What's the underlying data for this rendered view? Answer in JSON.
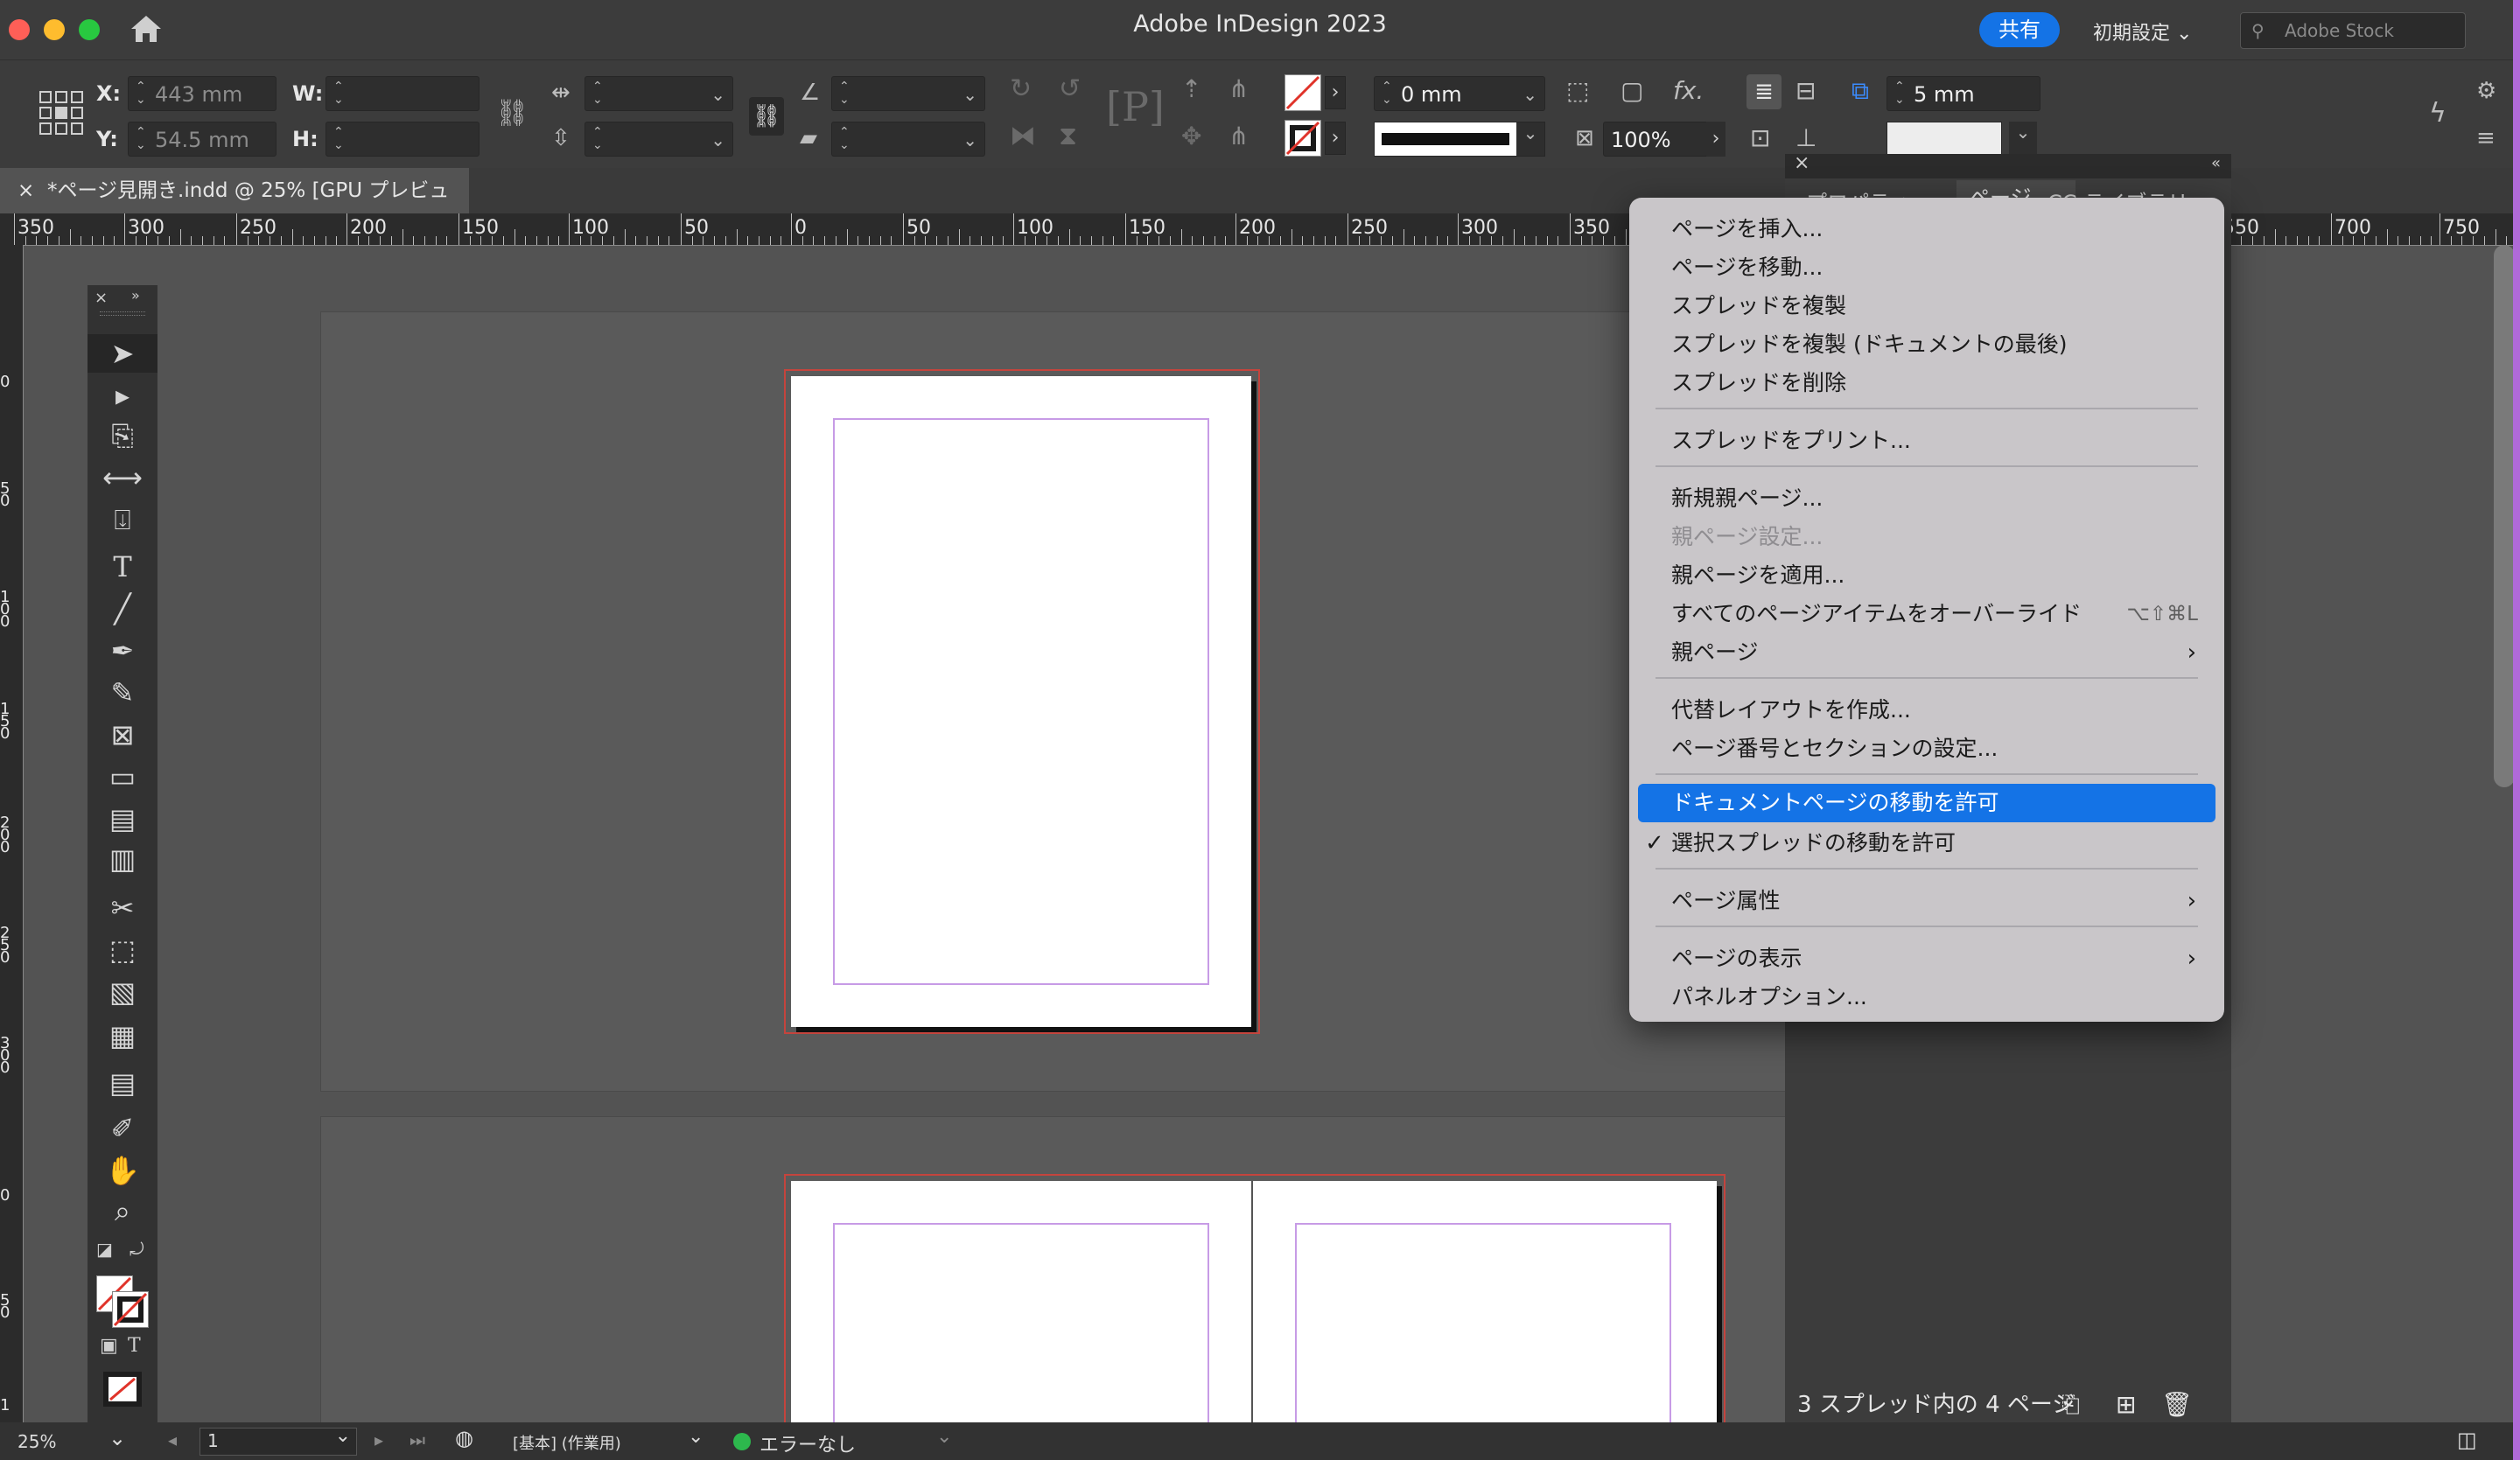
{
  "app": {
    "title": "Adobe InDesign 2023",
    "share_label": "共有",
    "workspace": "初期設定",
    "stock_placeholder": "Adobe Stock"
  },
  "control": {
    "x_label": "X:",
    "x_value": "443 mm",
    "y_label": "Y:",
    "y_value": "54.5 mm",
    "w_label": "W:",
    "w_value": "",
    "h_label": "H:",
    "h_value": "",
    "stroke_weight": "0 mm",
    "opacity": "100%",
    "spacing": "5 mm"
  },
  "tab": {
    "label": "*ページ見開き.indd @ 25% [GPU プレビュー]"
  },
  "ruler": {
    "labels": [
      "350",
      "300",
      "250",
      "200",
      "150",
      "100",
      "50",
      "0",
      "50",
      "100",
      "150",
      "200",
      "250",
      "300",
      "350",
      "550",
      "700",
      "750"
    ],
    "vlabels": [
      "0",
      "5\n0",
      "1\n0\n0",
      "1\n5\n0",
      "2\n0\n0",
      "2\n5\n0",
      "3\n0\n0",
      "0",
      "5\n0",
      "1"
    ]
  },
  "panel": {
    "tab1": "プロパティ",
    "tab2": "ページ",
    "tab3": "CC ライブラリ",
    "footer": "3 スプレッド内の 4 ページ"
  },
  "menu": {
    "items": [
      {
        "label": "ページを挿入..."
      },
      {
        "label": "ページを移動..."
      },
      {
        "label": "スプレッドを複製"
      },
      {
        "label": "スプレッドを複製 (ドキュメントの最後)"
      },
      {
        "label": "スプレッドを削除"
      },
      {
        "label": "スプレッドをプリント..."
      },
      {
        "label": "新規親ページ..."
      },
      {
        "label": "親ページ設定..."
      },
      {
        "label": "親ページを適用..."
      },
      {
        "label": "すべてのページアイテムをオーバーライド",
        "shortcut": "⌥⇧⌘L"
      },
      {
        "label": "親ページ"
      },
      {
        "label": "代替レイアウトを作成..."
      },
      {
        "label": "ページ番号とセクションの設定..."
      },
      {
        "label": "ドキュメントページの移動を許可"
      },
      {
        "label": "選択スプレッドの移動を許可"
      },
      {
        "label": "ページ属性"
      },
      {
        "label": "ページの表示"
      },
      {
        "label": "パネルオプション..."
      }
    ]
  },
  "status": {
    "zoom": "25%",
    "page": "1",
    "style": "[基本] (作業用)",
    "preflight": "エラーなし"
  },
  "colors": {
    "accent": "#1473e6",
    "bleed": "#c4443d",
    "margin": "#c79be6",
    "ok": "#2db84d"
  }
}
